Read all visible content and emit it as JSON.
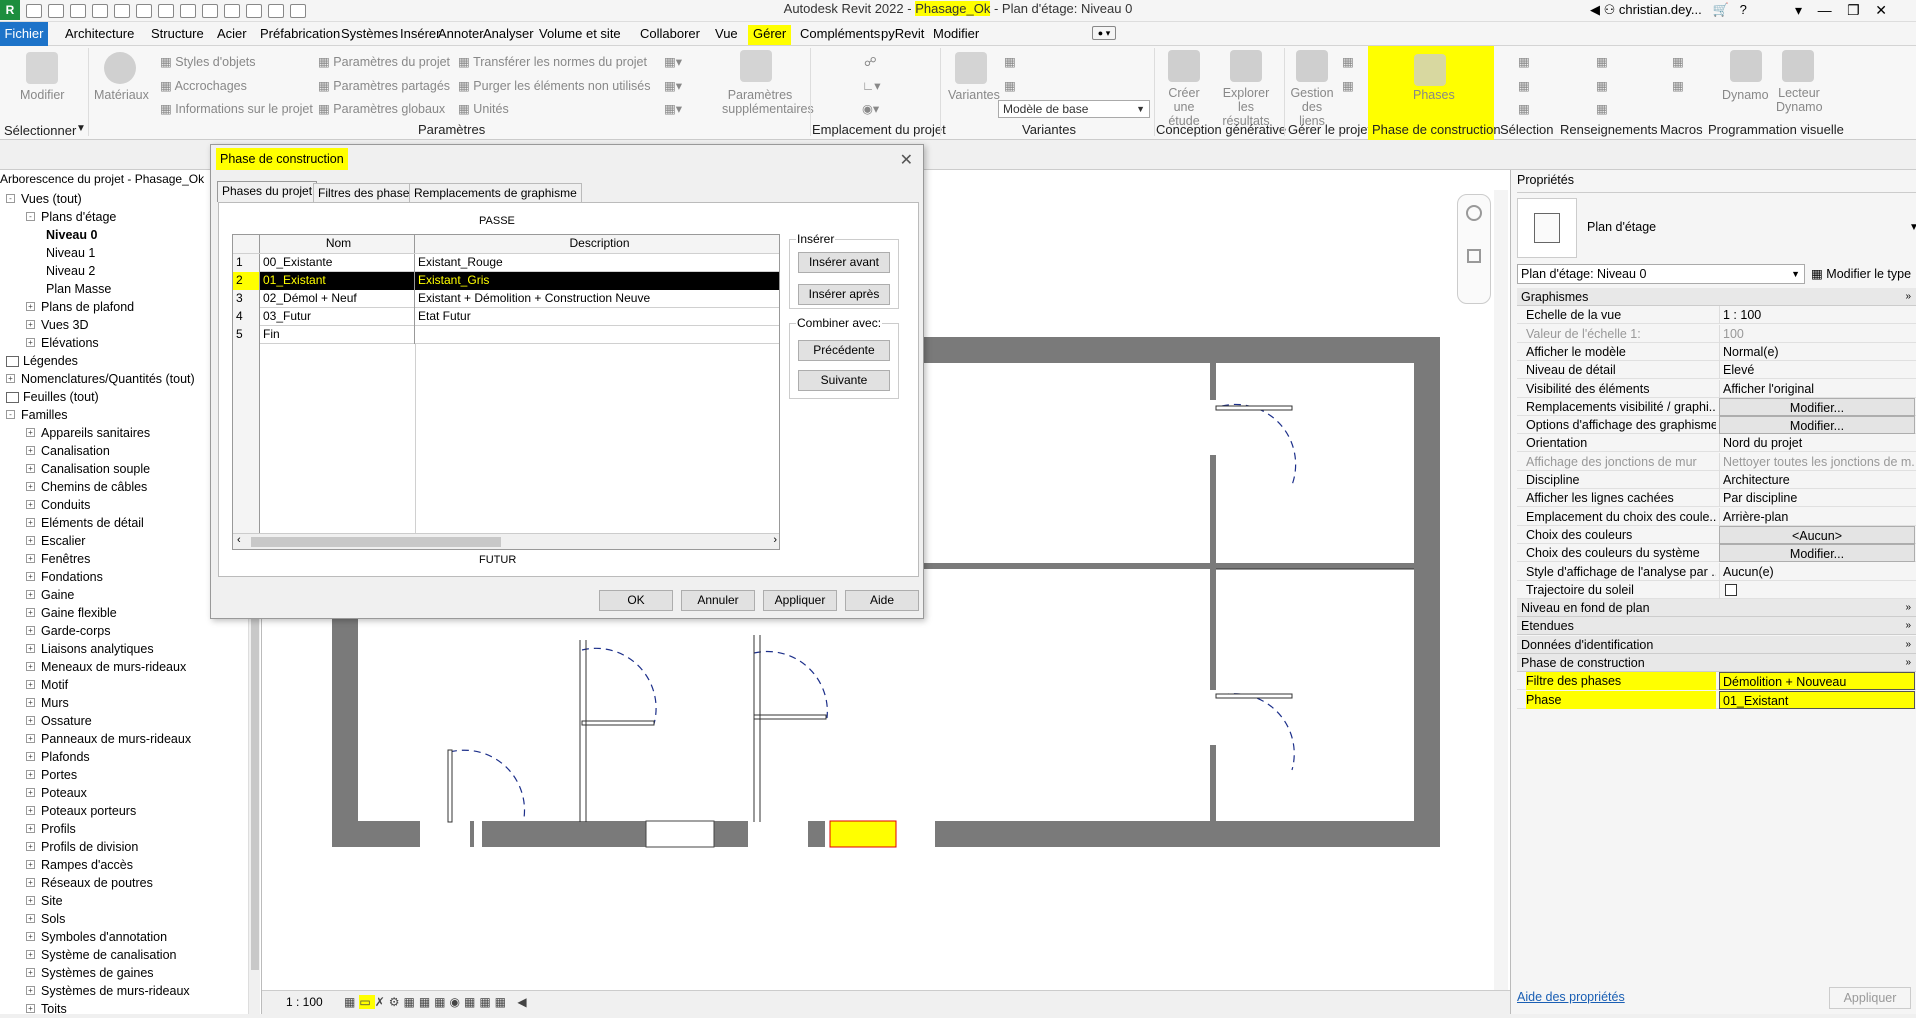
{
  "app": {
    "title_prefix": "Autodesk Revit 2022 - ",
    "project": "Phasage_Ok",
    "title_suffix": " - Plan d'étage: Niveau 0",
    "user": "christian.dey...",
    "help": "?"
  },
  "menu": {
    "file": "Fichier",
    "tabs": [
      "Architecture",
      "Structure",
      "Acier",
      "Préfabrication",
      "Systèmes",
      "Insérer",
      "Annoter",
      "Analyser",
      "Volume et site",
      "Collaborer",
      "Vue",
      "Gérer",
      "Compléments",
      "pyRevit",
      "Modifier"
    ],
    "active_tab": "Gérer"
  },
  "ribbon": {
    "modifier": "Modifier",
    "selectionner": "Sélectionner",
    "materiaux": "Matériaux",
    "styles_objets": "Styles d'objets",
    "accrochages": "Accrochages",
    "infos_projet": "Informations sur le projet",
    "param_projet": "Paramètres du projet",
    "param_partages": "Paramètres partagés",
    "param_globaux": "Paramètres globaux",
    "transferer": "Transférer les normes du projet",
    "purger": "Purger les éléments non utilisés",
    "unites": "Unités",
    "param_supp": "Paramètres supplémentaires",
    "panel_parametres": "Paramètres",
    "panel_emplacement": "Emplacement du projet",
    "variantes": "Variantes",
    "modele_base": "Modèle de base",
    "panel_variantes": "Variantes",
    "creer_etude": "Créer une étude",
    "explorer": "Explorer les résultats",
    "panel_conception": "Conception générative",
    "gestion_liens": "Gestion des liens",
    "panel_gerer": "Gérer le projet",
    "phases": "Phases",
    "panel_phase": "Phase de construction",
    "panel_selection": "Sélection",
    "panel_renseignements": "Renseignements",
    "panel_macros": "Macros",
    "dynamo": "Dynamo",
    "lecteur_dynamo": "Lecteur Dynamo",
    "panel_prog": "Programmation visuelle"
  },
  "browser": {
    "header": "Arborescence du projet - Phasage_Ok",
    "items": [
      {
        "label": "Vues (tout)",
        "lvl": 0,
        "ic": "-"
      },
      {
        "label": "Plans d'étage",
        "lvl": 1,
        "ic": "-"
      },
      {
        "label": "Niveau 0",
        "lvl": 2,
        "bold": true
      },
      {
        "label": "Niveau 1",
        "lvl": 2
      },
      {
        "label": "Niveau 2",
        "lvl": 2
      },
      {
        "label": "Plan Masse",
        "lvl": 2
      },
      {
        "label": "Plans de plafond",
        "lvl": 1,
        "ic": "+"
      },
      {
        "label": "Vues 3D",
        "lvl": 1,
        "ic": "+"
      },
      {
        "label": "Elévations",
        "lvl": 1,
        "ic": "+"
      },
      {
        "label": "Légendes",
        "lvl": 0,
        "ic": ""
      },
      {
        "label": "Nomenclatures/Quantités (tout)",
        "lvl": 0,
        "ic": "+"
      },
      {
        "label": "Feuilles (tout)",
        "lvl": 0,
        "ic": ""
      },
      {
        "label": "Familles",
        "lvl": 0,
        "ic": "-"
      },
      {
        "label": "Appareils sanitaires",
        "lvl": 1,
        "ic": "+"
      },
      {
        "label": "Canalisation",
        "lvl": 1,
        "ic": "+"
      },
      {
        "label": "Canalisation souple",
        "lvl": 1,
        "ic": "+"
      },
      {
        "label": "Chemins de câbles",
        "lvl": 1,
        "ic": "+"
      },
      {
        "label": "Conduits",
        "lvl": 1,
        "ic": "+"
      },
      {
        "label": "Eléments de détail",
        "lvl": 1,
        "ic": "+"
      },
      {
        "label": "Escalier",
        "lvl": 1,
        "ic": "+"
      },
      {
        "label": "Fenêtres",
        "lvl": 1,
        "ic": "+"
      },
      {
        "label": "Fondations",
        "lvl": 1,
        "ic": "+"
      },
      {
        "label": "Gaine",
        "lvl": 1,
        "ic": "+"
      },
      {
        "label": "Gaine flexible",
        "lvl": 1,
        "ic": "+"
      },
      {
        "label": "Garde-corps",
        "lvl": 1,
        "ic": "+"
      },
      {
        "label": "Liaisons analytiques",
        "lvl": 1,
        "ic": "+"
      },
      {
        "label": "Meneaux de murs-rideaux",
        "lvl": 1,
        "ic": "+"
      },
      {
        "label": "Motif",
        "lvl": 1,
        "ic": "+"
      },
      {
        "label": "Murs",
        "lvl": 1,
        "ic": "+"
      },
      {
        "label": "Ossature",
        "lvl": 1,
        "ic": "+"
      },
      {
        "label": "Panneaux de murs-rideaux",
        "lvl": 1,
        "ic": "+"
      },
      {
        "label": "Plafonds",
        "lvl": 1,
        "ic": "+"
      },
      {
        "label": "Portes",
        "lvl": 1,
        "ic": "+"
      },
      {
        "label": "Poteaux",
        "lvl": 1,
        "ic": "+"
      },
      {
        "label": "Poteaux porteurs",
        "lvl": 1,
        "ic": "+"
      },
      {
        "label": "Profils",
        "lvl": 1,
        "ic": "+"
      },
      {
        "label": "Profils de division",
        "lvl": 1,
        "ic": "+"
      },
      {
        "label": "Rampes d'accès",
        "lvl": 1,
        "ic": "+"
      },
      {
        "label": "Réseaux de poutres",
        "lvl": 1,
        "ic": "+"
      },
      {
        "label": "Site",
        "lvl": 1,
        "ic": "+"
      },
      {
        "label": "Sols",
        "lvl": 1,
        "ic": "+"
      },
      {
        "label": "Symboles d'annotation",
        "lvl": 1,
        "ic": "+"
      },
      {
        "label": "Système de canalisation",
        "lvl": 1,
        "ic": "+"
      },
      {
        "label": "Systèmes de gaines",
        "lvl": 1,
        "ic": "+"
      },
      {
        "label": "Systèmes de murs-rideaux",
        "lvl": 1,
        "ic": "+"
      },
      {
        "label": "Toits",
        "lvl": 1,
        "ic": "+"
      }
    ]
  },
  "view": {
    "scale": "1 : 100"
  },
  "dialog": {
    "title": "Phase de construction",
    "tabs": [
      "Phases du projet",
      "Filtres des phases",
      "Remplacements de graphisme"
    ],
    "passe": "PASSE",
    "futur": "FUTUR",
    "col_nom": "Nom",
    "col_desc": "Description",
    "rows": [
      {
        "n": "1",
        "nom": "00_Existante",
        "desc": "Existant_Rouge"
      },
      {
        "n": "2",
        "nom": "01_Existant",
        "desc": "Existant_Gris",
        "sel": true
      },
      {
        "n": "3",
        "nom": "02_Démol + Neuf",
        "desc": "Existant + Démolition + Construction Neuve"
      },
      {
        "n": "4",
        "nom": "03_Futur",
        "desc": "Etat Futur"
      },
      {
        "n": "5",
        "nom": "Fin",
        "desc": ""
      }
    ],
    "inserer": "Insérer",
    "inserer_avant": "Insérer avant",
    "inserer_apres": "Insérer après",
    "combiner": "Combiner avec:",
    "precedente": "Précédente",
    "suivante": "Suivante",
    "ok": "OK",
    "annuler": "Annuler",
    "appliquer": "Appliquer",
    "aide": "Aide"
  },
  "props": {
    "header": "Propriétés",
    "type_name": "Plan d'étage",
    "selector": "Plan d'étage: Niveau 0",
    "edit_type": "Modifier le type",
    "rows": [
      {
        "g": "Graphismes"
      },
      {
        "k": "Echelle de la vue",
        "v": "1 : 100"
      },
      {
        "k": "Valeur de l'échelle    1:",
        "v": "100",
        "grey": true
      },
      {
        "k": "Afficher le modèle",
        "v": "Normal(e)"
      },
      {
        "k": "Niveau de détail",
        "v": "Elevé"
      },
      {
        "k": "Visibilité des éléments",
        "v": "Afficher l'original"
      },
      {
        "k": "Remplacements visibilité / graphi...",
        "v": "Modifier...",
        "btn": true
      },
      {
        "k": "Options d'affichage des graphismes",
        "v": "Modifier...",
        "btn": true
      },
      {
        "k": "Orientation",
        "v": "Nord du projet"
      },
      {
        "k": "Affichage des jonctions de mur",
        "v": "Nettoyer toutes les jonctions de m...",
        "grey": true
      },
      {
        "k": "Discipline",
        "v": "Architecture"
      },
      {
        "k": "Afficher les lignes cachées",
        "v": "Par discipline"
      },
      {
        "k": "Emplacement du choix des coule...",
        "v": "Arrière-plan"
      },
      {
        "k": "Choix des couleurs",
        "v": "<Aucun>",
        "btn": true
      },
      {
        "k": "Choix des couleurs du système",
        "v": "Modifier...",
        "btn": true
      },
      {
        "k": "Style d'affichage de l'analyse par ...",
        "v": "Aucun(e)"
      },
      {
        "k": "Trajectoire du soleil",
        "v": "",
        "chk": true
      },
      {
        "g": "Niveau en fond de plan"
      },
      {
        "g": "Etendues"
      },
      {
        "g": "Données d'identification"
      },
      {
        "g": "Phase de construction",
        "hl": true
      },
      {
        "k": "Filtre des phases",
        "v": "Démolition + Nouveau",
        "hl": true
      },
      {
        "k": "Phase",
        "v": "01_Existant",
        "hl": true
      }
    ],
    "help_link": "Aide des propriétés",
    "apply": "Appliquer"
  }
}
